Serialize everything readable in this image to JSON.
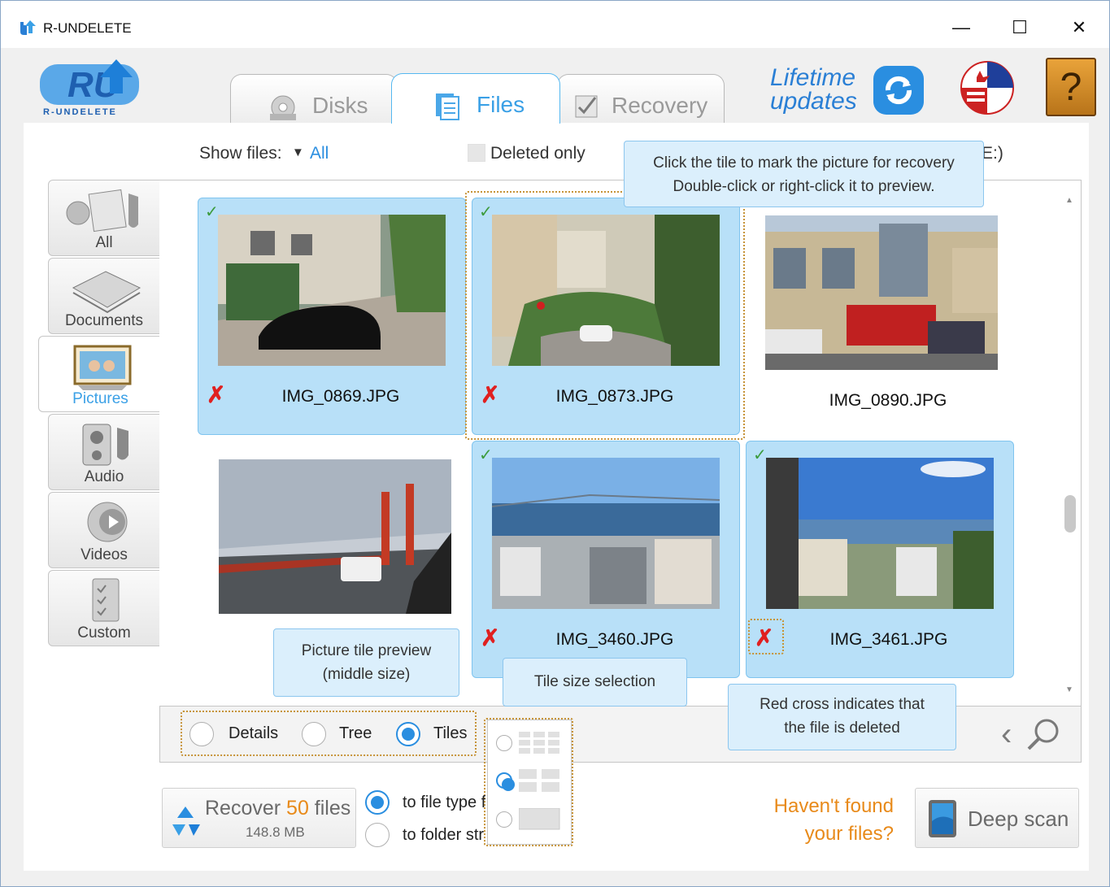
{
  "window": {
    "title": "R-UNDELETE",
    "minimize": "—",
    "maximize": "☐",
    "close": "✕"
  },
  "logo": {
    "text": "R-UNDELETE",
    "mark": "RU"
  },
  "tabs": [
    {
      "label": "Disks",
      "active": false
    },
    {
      "label": "Files",
      "active": true
    },
    {
      "label": "Recovery",
      "active": false
    }
  ],
  "header": {
    "lifetime_line1": "Lifetime",
    "lifetime_line2": "updates",
    "help": "?"
  },
  "toolbar": {
    "show_files_label": "Show files:",
    "show_files_value": "All",
    "deleted_only_label": "Deleted only",
    "drive_suffix": "E:)"
  },
  "nav": [
    {
      "label": "All",
      "active": false
    },
    {
      "label": "Documents",
      "active": false
    },
    {
      "label": "Pictures",
      "active": true
    },
    {
      "label": "Audio",
      "active": false
    },
    {
      "label": "Videos",
      "active": false
    },
    {
      "label": "Custom",
      "active": false
    }
  ],
  "tiles": [
    {
      "name": "IMG_0869.JPG",
      "selected": true,
      "deleted": true,
      "checked": true
    },
    {
      "name": "IMG_0873.JPG",
      "selected": true,
      "deleted": true,
      "checked": true
    },
    {
      "name": "IMG_0890.JPG",
      "selected": false,
      "deleted": false,
      "checked": false
    },
    {
      "name": "",
      "selected": false,
      "deleted": false,
      "checked": false
    },
    {
      "name": "IMG_3460.JPG",
      "selected": true,
      "deleted": true,
      "checked": true
    },
    {
      "name": "IMG_3461.JPG",
      "selected": true,
      "deleted": true,
      "checked": true
    }
  ],
  "tooltips": {
    "click_tile_line1": "Click the tile to mark the picture for recovery",
    "click_tile_line2": "Double-click or right-click it to preview.",
    "tile_preview_line1": "Picture tile preview",
    "tile_preview_line2": "(middle size)",
    "tile_size": "Tile size selection",
    "red_cross_line1": "Red cross indicates that",
    "red_cross_line2": "the file is deleted"
  },
  "view_modes": [
    {
      "label": "Details",
      "selected": false
    },
    {
      "label": "Tree",
      "selected": false
    },
    {
      "label": "Tiles",
      "selected": true
    }
  ],
  "recover": {
    "prefix": "Recover ",
    "count": "50",
    "suffix": " files",
    "size": "148.8 MB"
  },
  "destination": {
    "option1": "to file type f",
    "option2": "to folder str"
  },
  "havent_found": {
    "line1": "Haven't found",
    "line2": "your files?"
  },
  "deep_scan": {
    "label": "Deep scan"
  },
  "colors": {
    "accent": "#3aa0e6",
    "tile_selected": "#b8e0f8",
    "deleted_cross": "#e02020",
    "orange": "#e88a1a"
  }
}
